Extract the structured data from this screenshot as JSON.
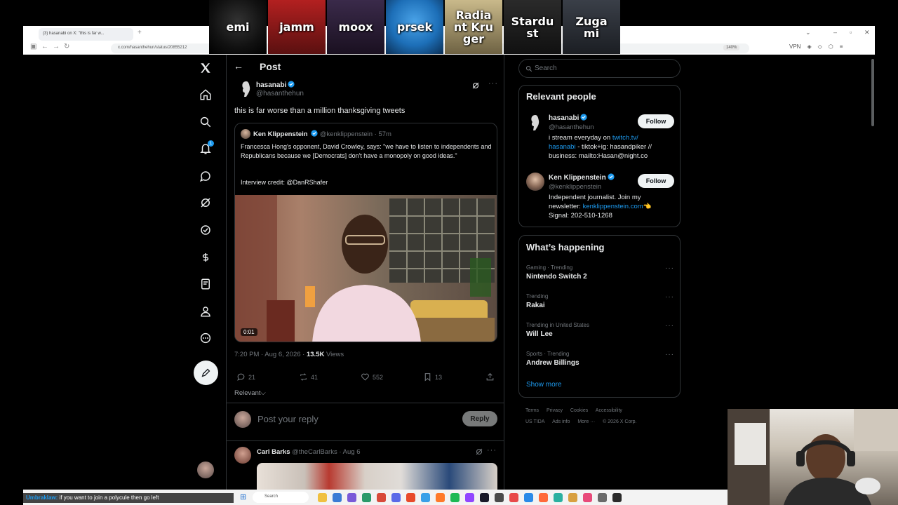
{
  "overlay": {
    "streamers": [
      "emi",
      "jamm",
      "moox",
      "prsek",
      "Radia\nnt Kru\nger",
      "Stardu\nst",
      "Zuga\nmi"
    ]
  },
  "browser": {
    "tab_title": "(3) hasanabi on X: \"this is far w...",
    "url": "x.com/hasanthehun/status/20855212",
    "zoom": "140%",
    "vpn": "VPN"
  },
  "nav": {
    "notification_count": "1"
  },
  "header": {
    "title": "Post"
  },
  "post": {
    "author_name": "hasanabi",
    "author_handle": "@hasanthehun",
    "text": "this is far worse than a million thanksgiving tweets",
    "quote": {
      "name": "Ken Klippenstein",
      "handle": "@kenklippenstein",
      "time": "57m",
      "text": "Francesca Hong's opponent, David Crowley, says: \"we have to listen to independents and Republicans because we [Democrats] don't have a monopoly on good ideas.\"",
      "credit": "Interview credit: @DanRShafer",
      "video_time": "0:01"
    },
    "timestamp": "7:20 PM · Aug 6, 2026 · ",
    "views": "13.5K",
    "views_label": " Views",
    "replies": "21",
    "reposts": "41",
    "likes": "552",
    "bookmarks": "13",
    "sort_label": "Relevant"
  },
  "reply": {
    "placeholder": "Post your reply",
    "button": "Reply"
  },
  "comment": {
    "name": "Carl Barks",
    "handle": "@theCarlBarks",
    "date": "· Aug 6"
  },
  "search": {
    "placeholder": "Search"
  },
  "relevant": {
    "title": "Relevant people",
    "people": [
      {
        "name": "hasanabi",
        "handle": "@hasanthehun",
        "bio_pre": "i stream everyday on ",
        "bio_link": "twitch.tv/\nhasanabi",
        "bio_post": " - tiktok+ig: hasandpiker // business: mailto:Hasan@night.co",
        "follow": "Follow"
      },
      {
        "name": "Ken Klippenstein",
        "handle": "@kenklippenstein",
        "bio_pre": "Independent journalist. Join my newsletter: ",
        "bio_link": "kenklippenstein.com",
        "bio_post": "👈\nSignal: 202-510-1268",
        "follow": "Follow"
      }
    ]
  },
  "happening": {
    "title": "What’s happening",
    "trends": [
      {
        "context": "Gaming · Trending",
        "name": "Nintendo Switch 2"
      },
      {
        "context": "Trending",
        "name": "Rakai"
      },
      {
        "context": "Trending in United States",
        "name": "Will Lee"
      },
      {
        "context": "Sports · Trending",
        "name": "Andrew Billings"
      }
    ],
    "show_more": "Show more"
  },
  "footer": {
    "links": [
      "Terms",
      "Privacy",
      "Cookies",
      "Accessibility",
      "US TIDA",
      "Ads info",
      "More ···",
      "© 2026 X Corp."
    ]
  },
  "taskbar": {
    "chat_user": "Umbraklaw:",
    "chat_text": " if you want to join a polycule then go left",
    "search": "Search"
  },
  "colors": {
    "accent": "#1d9bf0",
    "background": "#000000",
    "border": "#2f3336",
    "muted": "#71767b"
  }
}
